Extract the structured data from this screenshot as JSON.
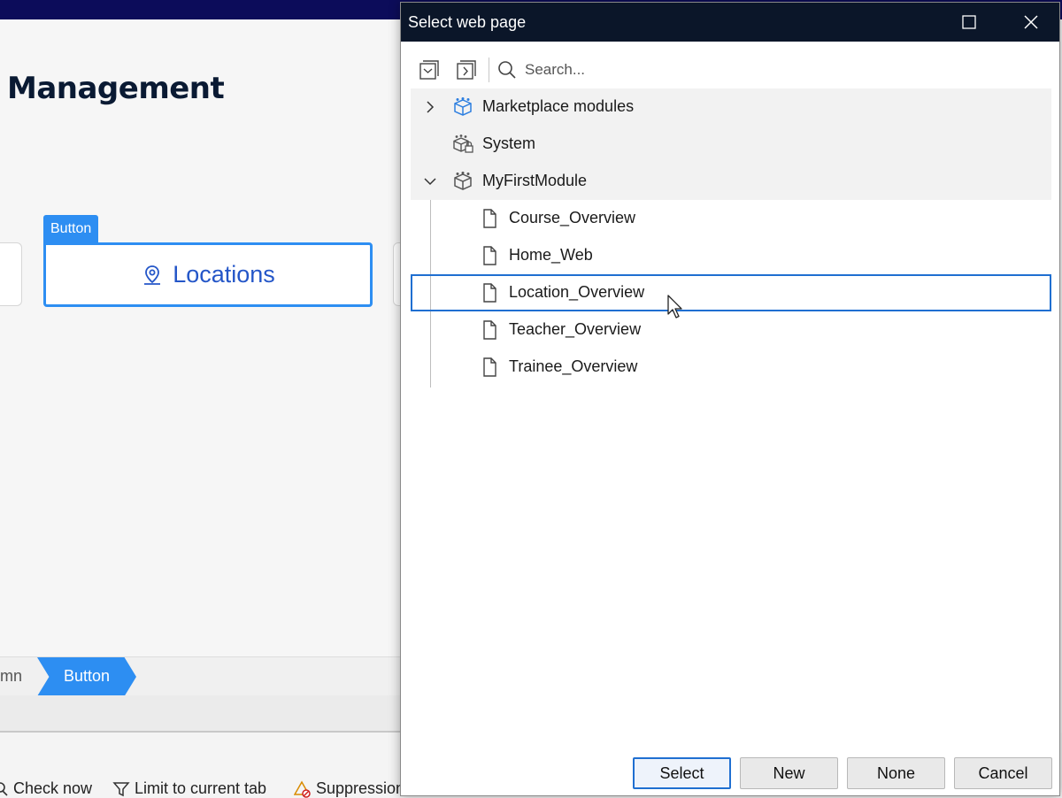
{
  "background": {
    "page_heading": "Management",
    "button_tag": "Button",
    "locations_button_label": "Locations",
    "breadcrumb": {
      "previous_fragment": "mn",
      "current": "Button"
    },
    "status_bar": {
      "check_now": "Check now",
      "limit_to_current_tab": "Limit to current tab",
      "suppression": "Suppression"
    }
  },
  "dialog": {
    "title": "Select web page",
    "search_placeholder": "Search...",
    "tree": [
      {
        "label": "Marketplace modules",
        "kind": "module",
        "expander": "collapsed"
      },
      {
        "label": "System",
        "kind": "system-module",
        "expander": "none"
      },
      {
        "label": "MyFirstModule",
        "kind": "module",
        "expander": "expanded"
      },
      {
        "label": "Course_Overview",
        "kind": "page"
      },
      {
        "label": "Home_Web",
        "kind": "page"
      },
      {
        "label": "Location_Overview",
        "kind": "page",
        "selected": true
      },
      {
        "label": "Teacher_Overview",
        "kind": "page"
      },
      {
        "label": "Trainee_Overview",
        "kind": "page"
      }
    ],
    "buttons": {
      "select": "Select",
      "new": "New",
      "none": "None",
      "cancel": "Cancel"
    }
  },
  "colors": {
    "accent": "#2d8ef2",
    "selection_border": "#1f6fd1",
    "title_bar": "#0b1629",
    "top_strip": "#0c0c5a",
    "heading": "#0a1a33"
  }
}
